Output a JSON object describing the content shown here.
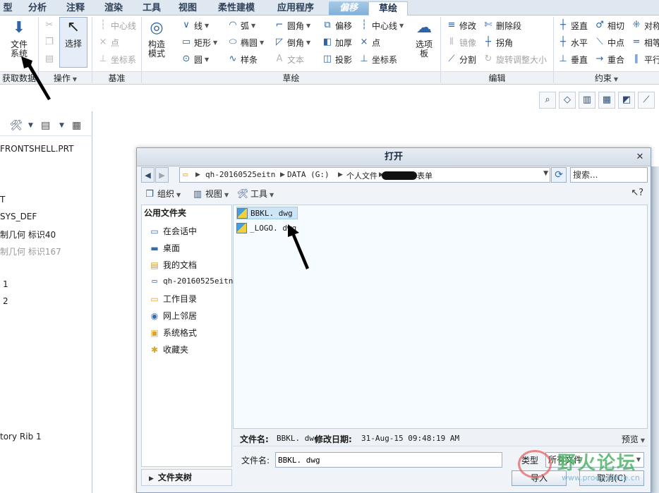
{
  "tabs": [
    "型",
    "分析",
    "注释",
    "渲染",
    "工具",
    "视图",
    "柔性建模",
    "应用程序",
    "偏移",
    "草绘"
  ],
  "ribbon": {
    "groups": {
      "get_data": "获取数据",
      "operations": "操作",
      "datum": "基准",
      "sketch": "草绘",
      "edit": "编辑",
      "constrain": "约束"
    },
    "file_system": "文件\n系统",
    "select": "选择",
    "datum_items": [
      "中心线",
      "点",
      "坐标系"
    ],
    "construct_mode": "构造\n模式",
    "sketch_col1": [
      "线",
      "矩形",
      "圆"
    ],
    "sketch_col2": [
      "弧",
      "椭圆",
      "样条"
    ],
    "sketch_col3": [
      "圆角",
      "倒角",
      "文本"
    ],
    "sketch_col4": [
      "偏移",
      "加厚",
      "投影"
    ],
    "sketch_col5": [
      "中心线",
      "点",
      "坐标系"
    ],
    "palette": "选项\n板",
    "edit_col1": [
      "修改",
      "镜像",
      "分割"
    ],
    "edit_col2": [
      "删除段",
      "拐角",
      "旋转调整大小"
    ],
    "constrain_col1": [
      "竖直",
      "水平",
      "垂直"
    ],
    "constrain_col2": [
      "相切",
      "中点",
      "重合"
    ],
    "constrain_col3": [
      "对称",
      "相等",
      "平行"
    ]
  },
  "model_tree": {
    "items": [
      "FRONTSHELL.PRT",
      "T",
      "SYS_DEF",
      "制几何 标识40",
      "制几何 标识167",
      "1",
      "2",
      "tory Rib 1"
    ]
  },
  "dialog": {
    "title": "打开",
    "path": [
      "qh-20160525eitn",
      "DATA (G:)",
      "个人文件",
      "表单"
    ],
    "search_placeholder": "搜索...",
    "toolbar": {
      "organize": "组织",
      "views": "视图",
      "tools": "工具"
    },
    "sidebar_title": "公用文件夹",
    "sidebar_items": [
      "在会话中",
      "桌面",
      "我的文档",
      "qh-20160525eitn",
      "工作目录",
      "网上邻居",
      "系统格式",
      "收藏夹"
    ],
    "folder_tree": "文件夹树",
    "files": [
      "BBKL. dwg",
      "_LOGO. dwg"
    ],
    "info": {
      "name_label": "文件名:",
      "name_value": "BBKL. dwg",
      "date_label": "修改日期:",
      "date_value": "31-Aug-15 09:48:19 AM",
      "preview": "预览"
    },
    "filename_label": "文件名:",
    "filename_value": "BBKL. dwg",
    "type_label": "类型",
    "type_value": "所有文件",
    "import": "导入",
    "cancel": "取消(C)"
  },
  "watermark": {
    "text": "野火论坛",
    "url": "www.proewildfire.cn"
  },
  "colors": {
    "accent": "#2e64a8",
    "selection": "#cde6f7",
    "annotation": "#000000",
    "watermark": "#52b26b"
  }
}
